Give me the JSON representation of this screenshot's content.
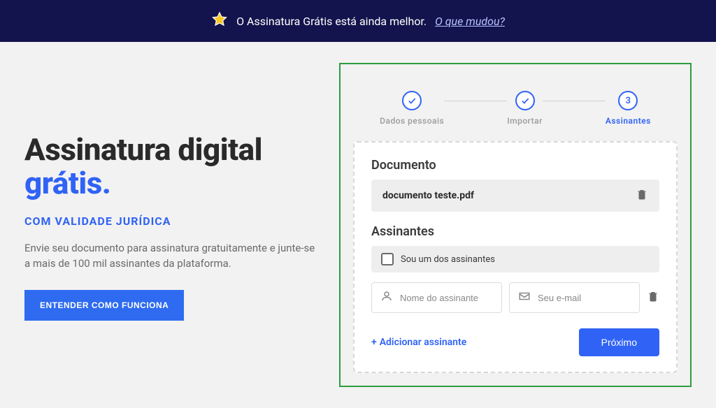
{
  "banner": {
    "text": "O Assinatura Grátis está ainda melhor.",
    "link_text": "O que mudou?"
  },
  "hero": {
    "headline_part1": "Assinatura digital ",
    "headline_part2": "grátis.",
    "subheadline": "COM VALIDADE JURÍDICA",
    "description": "Envie seu documento para assinatura gratuitamente e junte-se a mais de 100 mil assinantes da plataforma.",
    "cta_label": "ENTENDER COMO FUNCIONA"
  },
  "stepper": {
    "steps": [
      {
        "label": "Dados pessoais",
        "done": true
      },
      {
        "label": "Importar",
        "done": true
      },
      {
        "label": "Assinantes",
        "number": "3",
        "active": true
      }
    ]
  },
  "form": {
    "document_section_title": "Documento",
    "document_name": "documento teste.pdf",
    "signers_section_title": "Assinantes",
    "self_signer_label": "Sou um dos assinantes",
    "name_placeholder": "Nome do assinante",
    "email_placeholder": "Seu e-mail",
    "add_signer_label": "Adicionar assinante",
    "next_button_label": "Próximo"
  }
}
